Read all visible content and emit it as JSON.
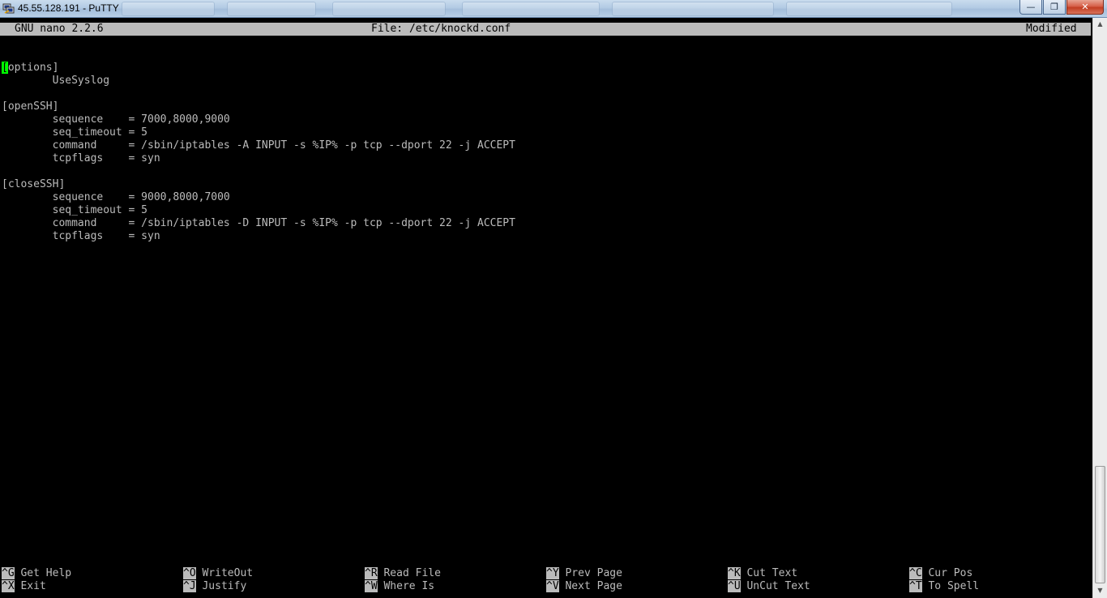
{
  "window": {
    "title": "45.55.128.191 - PuTTY",
    "controls": {
      "minimize": "—",
      "maximize": "❐",
      "close": "✕"
    }
  },
  "nano": {
    "version": "GNU nano 2.2.6",
    "file": "File: /etc/knockd.conf",
    "status": "Modified"
  },
  "editor": {
    "cursor_char": "[",
    "lines": [
      "",
      "",
      "options]",
      "        UseSyslog",
      "",
      "[openSSH]",
      "        sequence    = 7000,8000,9000",
      "        seq_timeout = 5",
      "        command     = /sbin/iptables -A INPUT -s %IP% -p tcp --dport 22 -j ACCEPT",
      "        tcpflags    = syn",
      "",
      "[closeSSH]",
      "        sequence    = 9000,8000,7000",
      "        seq_timeout = 5",
      "        command     = /sbin/iptables -D INPUT -s %IP% -p tcp --dport 22 -j ACCEPT",
      "        tcpflags    = syn"
    ]
  },
  "shortcuts": {
    "row1": [
      {
        "key": "^G",
        "label": "Get Help"
      },
      {
        "key": "^O",
        "label": "WriteOut"
      },
      {
        "key": "^R",
        "label": "Read File"
      },
      {
        "key": "^Y",
        "label": "Prev Page"
      },
      {
        "key": "^K",
        "label": "Cut Text"
      },
      {
        "key": "^C",
        "label": "Cur Pos"
      }
    ],
    "row2": [
      {
        "key": "^X",
        "label": "Exit"
      },
      {
        "key": "^J",
        "label": "Justify"
      },
      {
        "key": "^W",
        "label": "Where Is"
      },
      {
        "key": "^V",
        "label": "Next Page"
      },
      {
        "key": "^U",
        "label": "UnCut Text"
      },
      {
        "key": "^T",
        "label": "To Spell"
      }
    ]
  },
  "colors": {
    "terminal_bg": "#000000",
    "terminal_fg": "#bbbbbb",
    "cursor": "#00ff00",
    "titlebar": "#b3cbe4"
  }
}
